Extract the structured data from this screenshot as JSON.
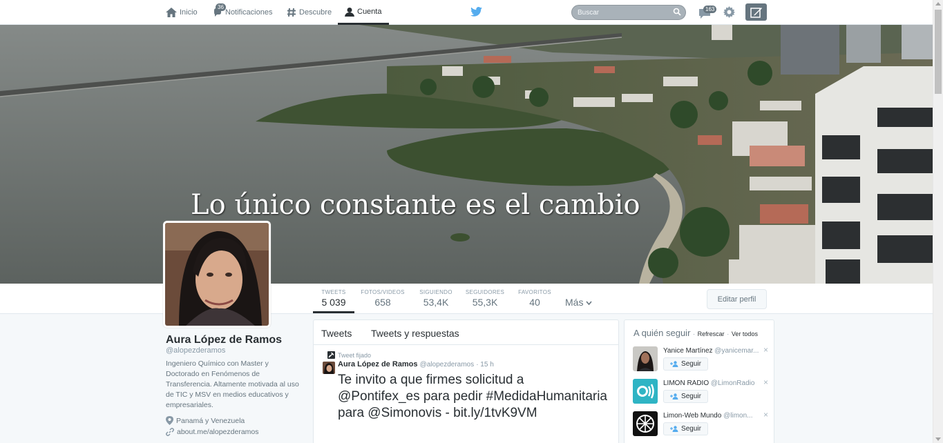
{
  "nav": {
    "items": [
      {
        "label": "Inicio",
        "icon": "home-icon"
      },
      {
        "label": "Notificaciones",
        "icon": "notifications-icon",
        "badge": "36"
      },
      {
        "label": "Descubre",
        "icon": "hashtag-icon"
      },
      {
        "label": "Cuenta",
        "icon": "account-icon",
        "active": true
      }
    ],
    "search_placeholder": "Buscar",
    "messages_badge": "163",
    "brand": "twitter-bird-icon"
  },
  "banner": {
    "quote": "Lo único constante es el cambio"
  },
  "stats": [
    {
      "label": "TWEETS",
      "value": "5 039"
    },
    {
      "label": "FOTOS/VIDEOS",
      "value": "658"
    },
    {
      "label": "SIGUIENDO",
      "value": "53,4K"
    },
    {
      "label": "SEGUIDORES",
      "value": "55,3K"
    },
    {
      "label": "FAVORITOS",
      "value": "40"
    }
  ],
  "more_label": "Más",
  "edit_profile_label": "Editar perfil",
  "profile": {
    "name": "Aura López de Ramos",
    "handle": "@alopezderamos",
    "bio": "Ingeniero Químico con Master y Doctorado en Fenómenos de Transferencia. Altamente motivada al uso de TIC y MSV en medios educativos y empresariales.",
    "location": "Panamá y Venezuela",
    "url": "about.me/alopezderamos"
  },
  "timeline": {
    "tabs": [
      "Tweets",
      "Tweets y respuestas"
    ],
    "pinned_label": "Tweet fijado",
    "tweet": {
      "author": "Aura López de Ramos",
      "handle": "@alopezderamos",
      "time": "· 15 h",
      "text": "Te invito a que firmes solicitud a @Pontifex_es para pedir #MedidaHumanitaria para @Simonovis - bit.ly/1tvK9VM"
    }
  },
  "who_to_follow": {
    "title": "A quién seguir",
    "refresh": "Refrescar",
    "view_all": "Ver todos",
    "follow_label": "Seguir",
    "close": "×",
    "suggestions": [
      {
        "name": "Yanice Martínez",
        "handle": "@yanicemar..."
      },
      {
        "name": "LIMÓN RADIO",
        "handle": "@LimonRadio"
      },
      {
        "name": "Limon-Web Mundo",
        "handle": "@limon..."
      }
    ]
  },
  "colors": {
    "brand_blue": "#55acee",
    "limon_teal": "#2fb4c4"
  }
}
